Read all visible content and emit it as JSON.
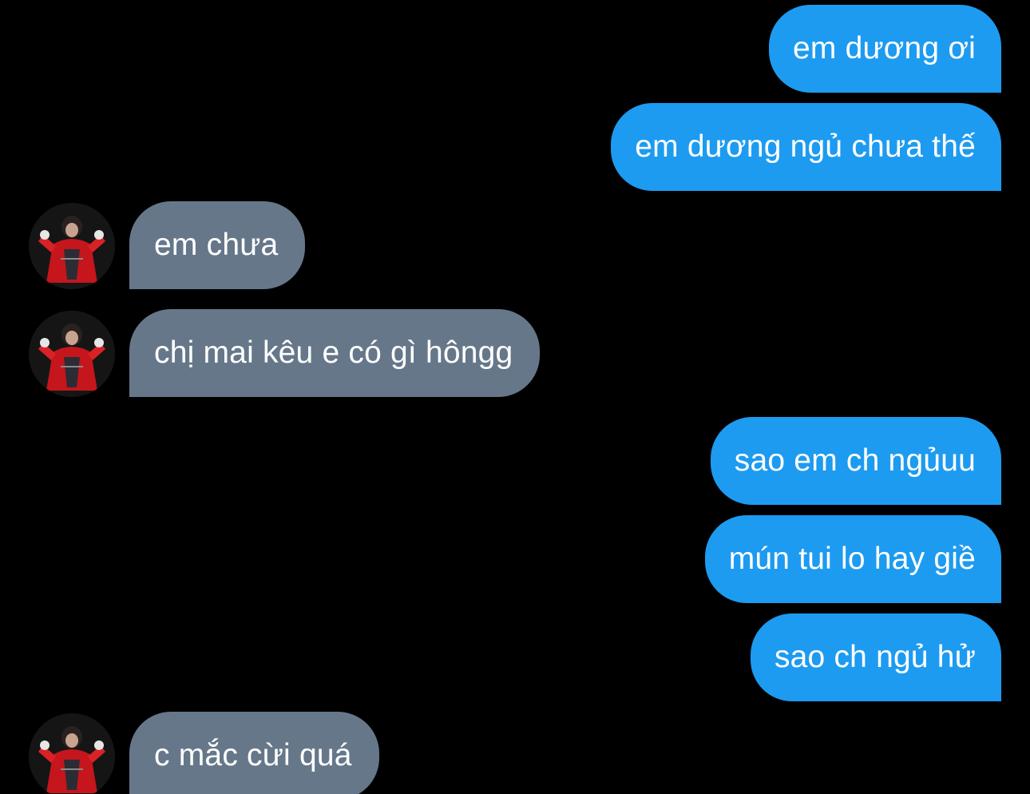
{
  "messages": [
    {
      "direction": "outgoing",
      "text": "em dương ơi"
    },
    {
      "direction": "outgoing",
      "text": "em dương ngủ chưa thế"
    },
    {
      "direction": "incoming",
      "text": "em chưa"
    },
    {
      "direction": "incoming",
      "text": "chị mai kêu e có gì hôngg"
    },
    {
      "direction": "outgoing",
      "text": "sao em ch ngủuu"
    },
    {
      "direction": "outgoing",
      "text": "mún tui lo hay giề"
    },
    {
      "direction": "outgoing",
      "text": "sao ch ngủ hử"
    },
    {
      "direction": "incoming",
      "text": "c mắc cừi quá"
    }
  ],
  "colors": {
    "background": "#000000",
    "outgoing_bubble": "#1d9bf0",
    "incoming_bubble": "#66778a",
    "text": "#ffffff"
  },
  "icons": {
    "avatar": "contact-avatar-photo"
  }
}
